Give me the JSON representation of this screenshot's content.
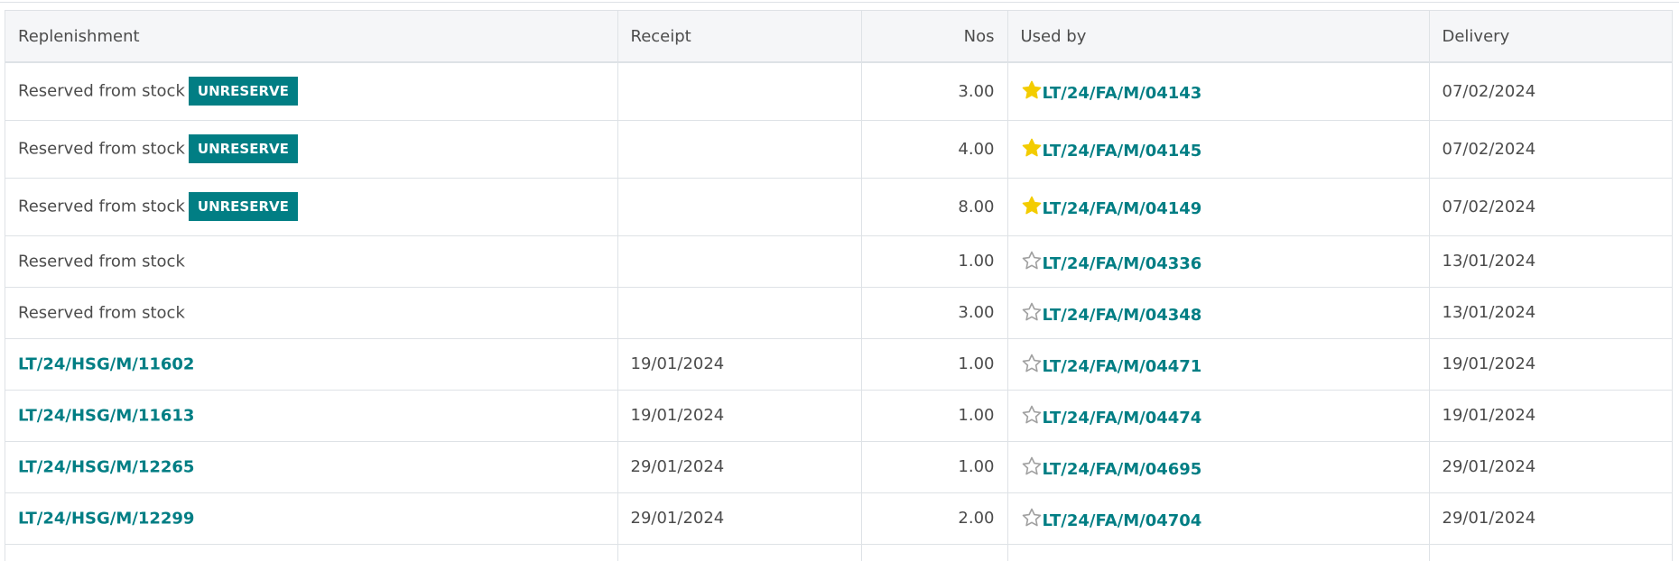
{
  "columns": {
    "replenishment": "Replenishment",
    "receipt": "Receipt",
    "nos": "Nos",
    "used_by": "Used by",
    "delivery": "Delivery"
  },
  "colors": {
    "accent": "#017e84",
    "star_filled": "#f3cc00",
    "star_empty": "#a0a0a0"
  },
  "unreserve_label": "UNRESERVE",
  "rows": [
    {
      "replenishment": "Reserved from stock",
      "replenishment_is_link": false,
      "has_unreserve": true,
      "receipt": "",
      "nos": "3.00",
      "starred": true,
      "used_by": "LT/24/FA/M/04143",
      "delivery": "07/02/2024"
    },
    {
      "replenishment": "Reserved from stock",
      "replenishment_is_link": false,
      "has_unreserve": true,
      "receipt": "",
      "nos": "4.00",
      "starred": true,
      "used_by": "LT/24/FA/M/04145",
      "delivery": "07/02/2024"
    },
    {
      "replenishment": "Reserved from stock",
      "replenishment_is_link": false,
      "has_unreserve": true,
      "receipt": "",
      "nos": "8.00",
      "starred": true,
      "used_by": "LT/24/FA/M/04149",
      "delivery": "07/02/2024"
    },
    {
      "replenishment": "Reserved from stock",
      "replenishment_is_link": false,
      "has_unreserve": false,
      "receipt": "",
      "nos": "1.00",
      "starred": false,
      "used_by": "LT/24/FA/M/04336",
      "delivery": "13/01/2024"
    },
    {
      "replenishment": "Reserved from stock",
      "replenishment_is_link": false,
      "has_unreserve": false,
      "receipt": "",
      "nos": "3.00",
      "starred": false,
      "used_by": "LT/24/FA/M/04348",
      "delivery": "13/01/2024"
    },
    {
      "replenishment": "LT/24/HSG/M/11602",
      "replenishment_is_link": true,
      "has_unreserve": false,
      "receipt": "19/01/2024",
      "nos": "1.00",
      "starred": false,
      "used_by": "LT/24/FA/M/04471",
      "delivery": "19/01/2024"
    },
    {
      "replenishment": "LT/24/HSG/M/11613",
      "replenishment_is_link": true,
      "has_unreserve": false,
      "receipt": "19/01/2024",
      "nos": "1.00",
      "starred": false,
      "used_by": "LT/24/FA/M/04474",
      "delivery": "19/01/2024"
    },
    {
      "replenishment": "LT/24/HSG/M/12265",
      "replenishment_is_link": true,
      "has_unreserve": false,
      "receipt": "29/01/2024",
      "nos": "1.00",
      "starred": false,
      "used_by": "LT/24/FA/M/04695",
      "delivery": "29/01/2024"
    },
    {
      "replenishment": "LT/24/HSG/M/12299",
      "replenishment_is_link": true,
      "has_unreserve": false,
      "receipt": "29/01/2024",
      "nos": "2.00",
      "starred": false,
      "used_by": "LT/24/FA/M/04704",
      "delivery": "29/01/2024"
    }
  ]
}
